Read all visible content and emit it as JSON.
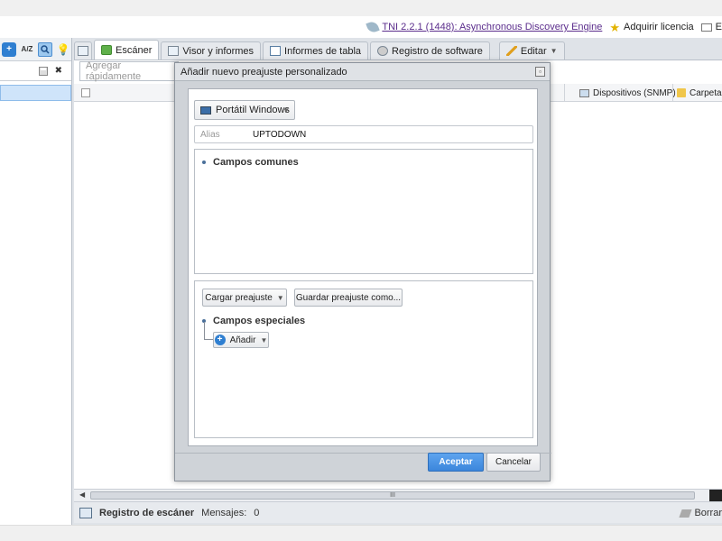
{
  "app": {
    "title_link": "TNI 2.2.1 (1448): Asynchronous Discovery Engine",
    "license": "Adquirir licencia",
    "email_partial": "E"
  },
  "tabs": [
    {
      "label": "Escáner"
    },
    {
      "label": "Visor y informes"
    },
    {
      "label": "Informes de tabla"
    },
    {
      "label": "Registro de software"
    },
    {
      "label": "Editar"
    }
  ],
  "main": {
    "filter_placeholder": "Agregar rápidamente",
    "columns": [
      "Dispositivos (SNMP)",
      "Carpeta d"
    ]
  },
  "left": {
    "az_label": "A/Z"
  },
  "status": {
    "title": "Registro de escáner",
    "messages_label": "Mensajes:",
    "messages_count": "0",
    "right_label": "Borrar"
  },
  "scroll": {
    "thumb_label": "III"
  },
  "dialog": {
    "title": "Añadir nuevo preajuste personalizado",
    "device_type": "Portátil Windows",
    "alias_label": "Alias",
    "alias_value": "UPTODOWN",
    "common_fields": "Campos comunes",
    "load_preset": "Cargar preajuste",
    "save_preset": "Guardar preajuste como...",
    "special_fields": "Campos especiales",
    "add": "Añadir",
    "accept": "Aceptar",
    "cancel": "Cancelar"
  },
  "colors": {
    "accent": "#3b86dc",
    "link": "#5b2d8c",
    "selection": "#cfe4fa"
  }
}
